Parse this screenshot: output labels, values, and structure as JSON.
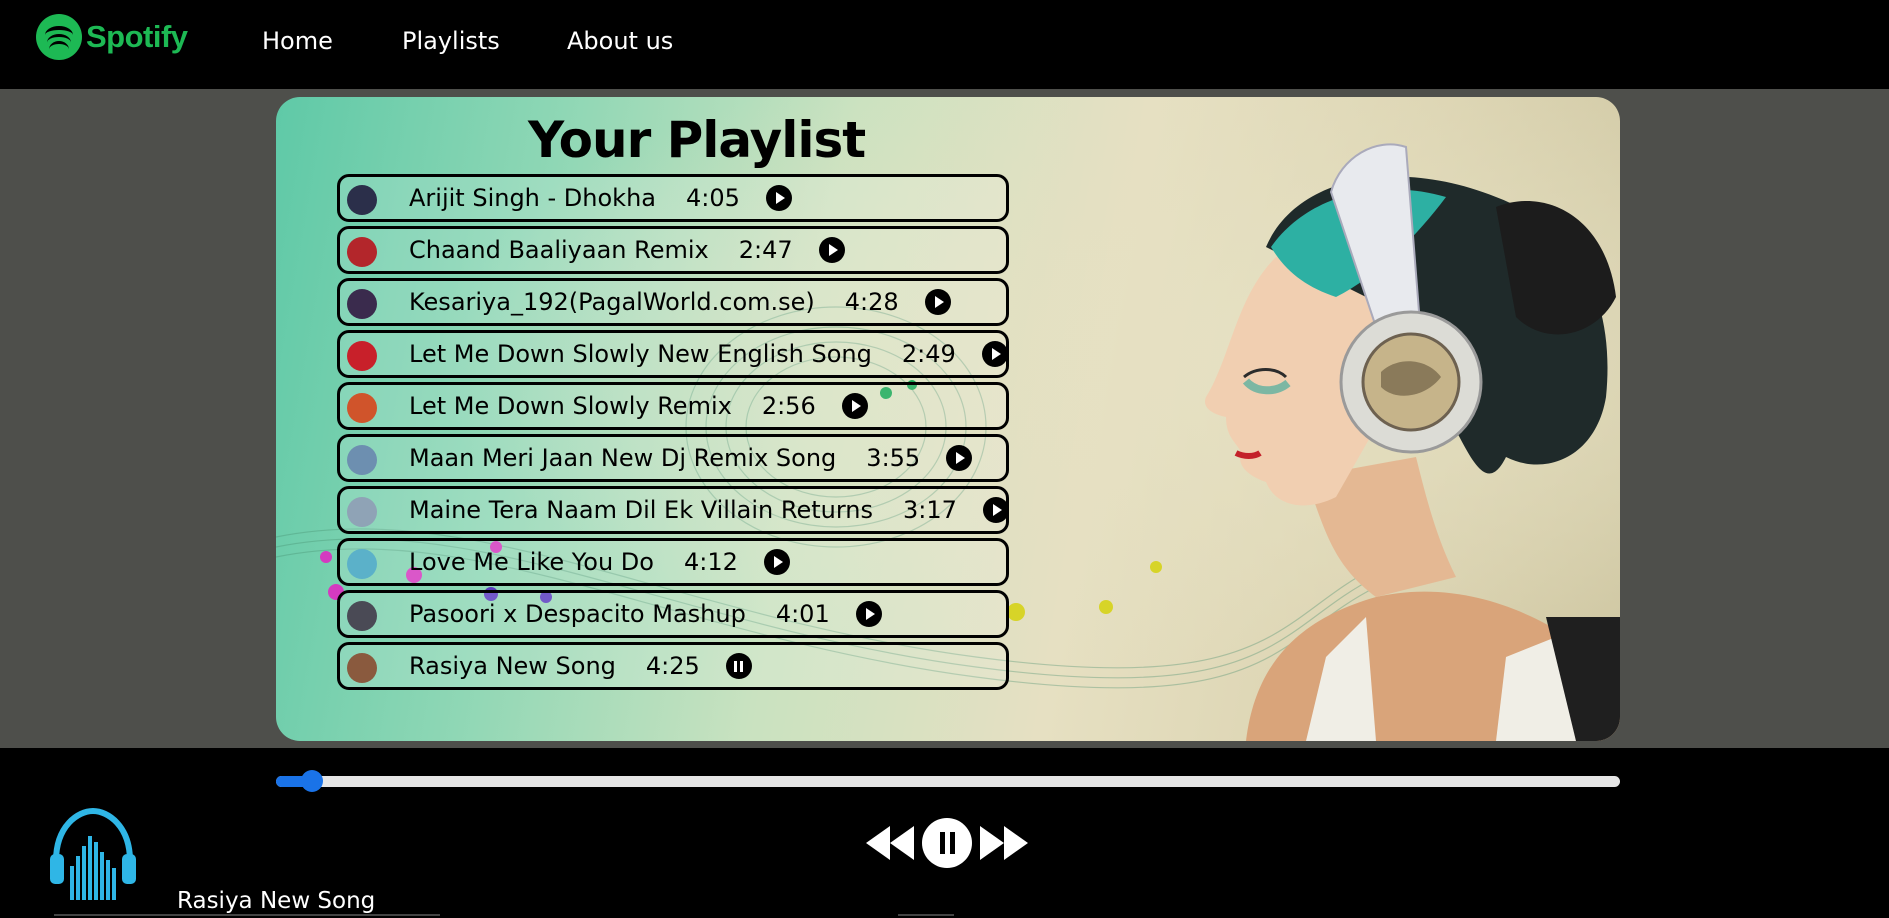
{
  "brand": {
    "name": "Spotify",
    "color": "#1DB954"
  },
  "nav": {
    "links": [
      {
        "label": "Home"
      },
      {
        "label": "Playlists"
      },
      {
        "label": "About us"
      }
    ]
  },
  "playlist": {
    "title": "Your Playlist",
    "tracks": [
      {
        "title": "Arijit Singh - Dhokha",
        "duration": "4:05",
        "state": "play",
        "thumb_color": "#2b2f4a"
      },
      {
        "title": "Chaand Baaliyaan Remix",
        "duration": "2:47",
        "state": "play",
        "thumb_color": "#b3262b"
      },
      {
        "title": "Kesariya_192(PagalWorld.com.se)",
        "duration": "4:28",
        "state": "play",
        "thumb_color": "#3a2b4d"
      },
      {
        "title": "Let Me Down Slowly New English Song",
        "duration": "2:49",
        "state": "play",
        "thumb_color": "#c8202a"
      },
      {
        "title": "Let Me Down Slowly Remix",
        "duration": "2:56",
        "state": "play",
        "thumb_color": "#d0542b"
      },
      {
        "title": "Maan Meri Jaan New Dj Remix Song",
        "duration": "3:55",
        "state": "play",
        "thumb_color": "#6d8fb0"
      },
      {
        "title": "Maine Tera Naam Dil Ek Villain Returns",
        "duration": "3:17",
        "state": "play",
        "thumb_color": "#8fa3b6"
      },
      {
        "title": "Love Me Like You Do",
        "duration": "4:12",
        "state": "play",
        "thumb_color": "#5bb1c9"
      },
      {
        "title": "Pasoori x Despacito Mashup",
        "duration": "4:01",
        "state": "play",
        "thumb_color": "#4a4a55"
      },
      {
        "title": "Rasiya New Song",
        "duration": "4:25",
        "state": "pause",
        "thumb_color": "#8a5a3e"
      }
    ]
  },
  "player": {
    "progress": 0.027,
    "now_playing": "Rasiya New Song",
    "state": "playing",
    "accent": "#1a73e8"
  },
  "icons": {
    "previous": "previous-icon",
    "pause": "pause-icon",
    "next": "next-icon",
    "now_playing_art": "headphones-equalizer-icon"
  }
}
